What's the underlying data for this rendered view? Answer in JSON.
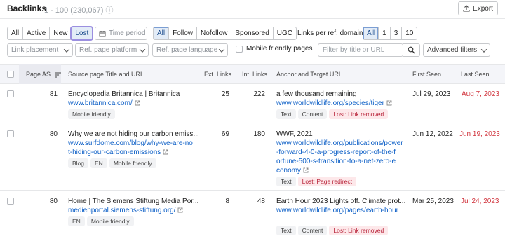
{
  "header": {
    "title": "Backlinks",
    "count": "1 - 100 (230,067)",
    "export_label": "Export"
  },
  "filters": {
    "status_tabs": [
      "All",
      "Active",
      "New",
      "Lost"
    ],
    "status_selected": "Lost",
    "time_period": "Time period",
    "type_tabs": [
      "All",
      "Follow",
      "Nofollow",
      "Sponsored",
      "UGC"
    ],
    "type_selected": "All",
    "links_per_domain_label": "Links per ref. domain",
    "links_per_domain": [
      "All",
      "1",
      "3",
      "10"
    ],
    "links_per_domain_selected": "All",
    "link_placement": "Link placement",
    "ref_page_platform": "Ref. page platform",
    "ref_page_language": "Ref. page language",
    "mobile_friendly_label": "Mobile friendly pages",
    "search_placeholder": "Filter by title or URL",
    "advanced_filters": "Advanced filters"
  },
  "table": {
    "columns": {
      "page_as": "Page AS",
      "source": "Source page Title and URL",
      "ext_links": "Ext. Links",
      "int_links": "Int. Links",
      "anchor": "Anchor and Target URL",
      "first_seen": "First Seen",
      "last_seen": "Last Seen"
    },
    "rows": [
      {
        "as": "81",
        "title": "Encyclopedia Britannica | Britannica",
        "url": [
          "www.britannica.com/"
        ],
        "tags": [
          "Mobile friendly"
        ],
        "ext": "25",
        "int": "222",
        "anchor": "a few thousand remaining",
        "target": [
          "www.worldwildlife.org/species/tiger"
        ],
        "anchor_tags": [
          "Text",
          "Content"
        ],
        "lost_tag": "Lost: Link removed",
        "first_seen": "Jul 29, 2023",
        "last_seen": "Aug 7, 2023"
      },
      {
        "as": "80",
        "title": "Why we are not hiding our carbon emiss...",
        "url": [
          "www.surfdome.com/blog/why-we-are-no",
          "t-hiding-our-carbon-emissions"
        ],
        "tags": [
          "Blog",
          "EN",
          "Mobile friendly"
        ],
        "ext": "69",
        "int": "180",
        "anchor": "WWF, 2021",
        "target": [
          "www.worldwildlife.org/publications/power",
          "-forward-4-0-a-progress-report-of-the-f",
          "ortune-500-s-transition-to-a-net-zero-e",
          "conomy"
        ],
        "anchor_tags": [
          "Text"
        ],
        "lost_tag": "Lost: Page redirect",
        "first_seen": "Jun 12, 2022",
        "last_seen": "Jun 19, 2023"
      },
      {
        "as": "80",
        "title": "Home | The Siemens Stiftung Media Por...",
        "url": [
          "medienportal.siemens-stiftung.org/"
        ],
        "tags": [
          "EN",
          "Mobile friendly"
        ],
        "ext": "8",
        "int": "48",
        "anchor": "Earth Hour 2023 Lights off. Climate prot...",
        "target": [
          "www.worldwildlife.org/pages/earth-hour"
        ],
        "anchor_tags": [
          "Text",
          "Content"
        ],
        "lost_tag": "Lost: Link removed",
        "first_seen": "Mar 25, 2023",
        "last_seen": "Jul 24, 2023"
      }
    ]
  },
  "colors": {
    "link": "#0b5ec6",
    "lost": "#d1343d",
    "active_tab": "#e3ecf7",
    "lost_outline": "#9b8fe0"
  },
  "icons": [
    "info-icon",
    "export-icon",
    "calendar-icon",
    "chevron-down-icon",
    "search-icon",
    "sort-icon",
    "external-link-icon"
  ]
}
